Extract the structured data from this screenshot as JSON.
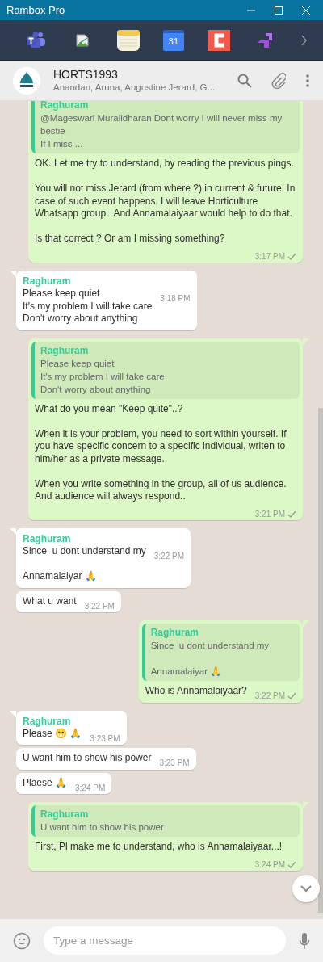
{
  "window": {
    "title": "Rambox Pro"
  },
  "apps": [
    {
      "kind": "teams"
    },
    {
      "kind": "broken-image"
    },
    {
      "kind": "notes"
    },
    {
      "kind": "calendar",
      "label": "31"
    },
    {
      "kind": "red-app"
    },
    {
      "kind": "purple-app"
    }
  ],
  "chat_header": {
    "title": "HORTS1993",
    "subtitle": "Anandan, Aruna, Augustine Jerard, G..."
  },
  "messages": [
    {
      "kind": "outgoing",
      "tail": false,
      "quote": {
        "sender": "Raghuram",
        "text": "@Mageswari Muralidharan Dont worry I will never miss my bestie\nIf I miss ..."
      },
      "text": "OK. Let me try to understand, by reading the previous pings.\n\nYou will not miss Jerard (from where ?) in current & future. In case of such event happens, I will leave Horticulture Whatsapp group.  And Annamalaiyaar would help to do that.\n\nIs that correct ? Or am I missing something?",
      "time": "3:17 PM",
      "ticked": true
    },
    {
      "kind": "incoming",
      "tail": true,
      "sender": "Raghuram",
      "text": "Please keep quiet\nIt's my problem I will take care\nDon't worry about anything",
      "time": "3:18 PM"
    },
    {
      "kind": "outgoing",
      "tail": true,
      "quote": {
        "sender": "Raghuram",
        "text": "Please keep quiet\nIt's my problem I will take care\nDon't worry about anything"
      },
      "text": "What do you mean \"Keep quite\"..?\n\nWhen it is your problem, you need to sort within yourself. If you have specific concern to a specific individual, writen to him/her as a private message.\n\nWhen you write something in the group, all of us audience. And audience will always respond..",
      "time": "3:21 PM",
      "ticked": true
    },
    {
      "kind": "incoming",
      "tail": true,
      "sender": "Raghuram",
      "text": "Since  u dont understand my\n\nAnnamalaiyar 🙏",
      "time": "3:22 PM"
    },
    {
      "kind": "incoming",
      "tail": false,
      "text": "What u want",
      "time": "3:22 PM"
    },
    {
      "kind": "outgoing",
      "tail": true,
      "quote": {
        "sender": "Raghuram",
        "text": "Since  u dont understand my\n\nAnnamalaiyar 🙏"
      },
      "text": "Who is Annamalaiyaar?",
      "time": "3:22 PM",
      "ticked": true
    },
    {
      "kind": "incoming",
      "tail": true,
      "sender": "Raghuram",
      "text": "Please 😁 🙏",
      "time": "3:23 PM"
    },
    {
      "kind": "incoming",
      "tail": false,
      "text": "U want him to show his power",
      "time": "3:23 PM"
    },
    {
      "kind": "incoming",
      "tail": false,
      "text": "Plaese 🙏",
      "time": "3:24 PM"
    },
    {
      "kind": "outgoing",
      "tail": true,
      "quote": {
        "sender": "Raghuram",
        "text": "U want him to show his power"
      },
      "text": "First, Pl make me to understand, who is Annamalaiyaar...!",
      "time": "3:24 PM",
      "ticked": true
    }
  ],
  "composer": {
    "placeholder": "Type a message"
  }
}
